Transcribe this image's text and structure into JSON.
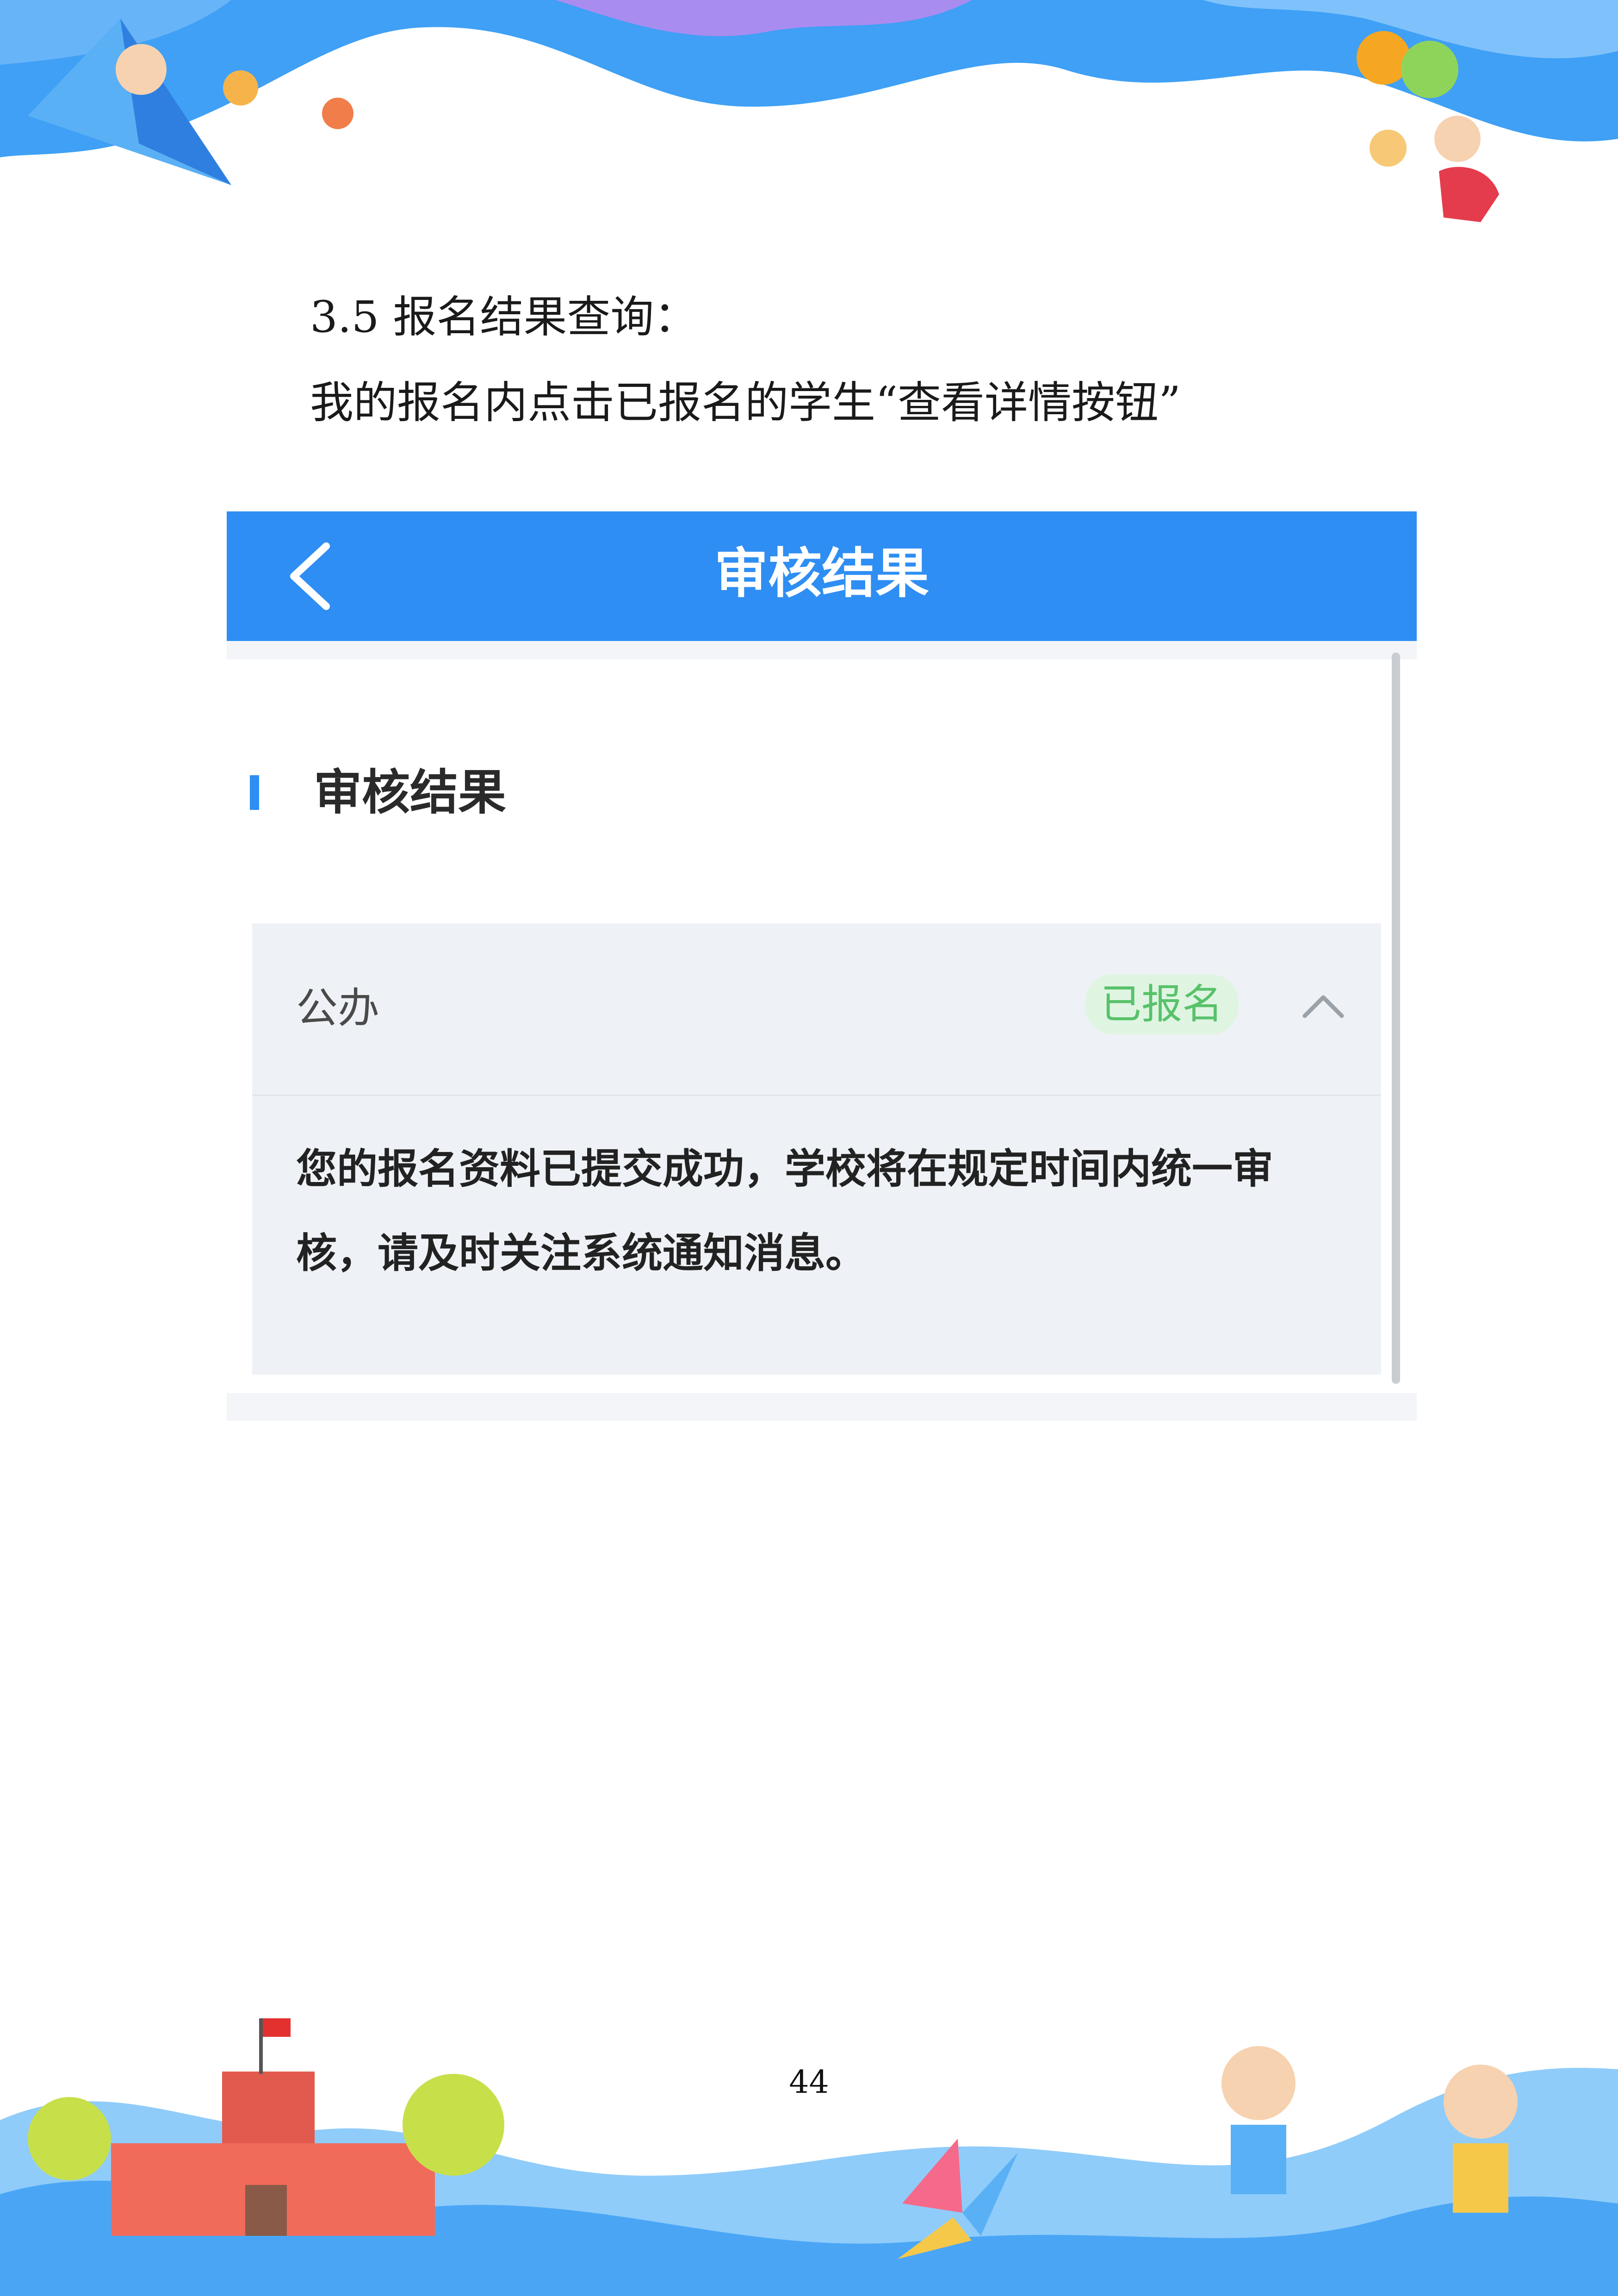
{
  "document": {
    "heading": "3.5 报名结果查询：",
    "instruction": "我的报名内点击已报名的学生“查看详情按钮”",
    "page_number": "44"
  },
  "nav": {
    "title": "审核结果",
    "back_icon": "chevron-left-icon"
  },
  "section": {
    "title": "审核结果"
  },
  "card": {
    "type": "公办",
    "status": "已报名",
    "toggle_icon": "chevron-up-icon",
    "message": "您的报名资料已提交成功，学校将在规定时间内统一审核，请及时关注系统通知消息。"
  },
  "colors": {
    "nav_bg": "#2e8ef3",
    "status_text": "#58c26a",
    "status_bg": "#dff5e2",
    "card_bg": "#eef1f5"
  }
}
